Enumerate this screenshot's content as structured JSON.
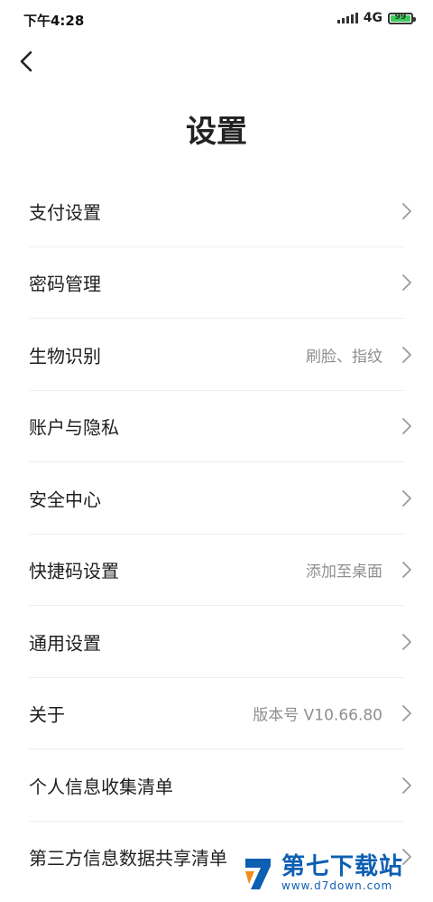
{
  "status_bar": {
    "time": "下午4:28",
    "network": "4G",
    "battery": "99",
    "battery_level": 0.99,
    "battery_color": "#3ec95c"
  },
  "header": {
    "back_icon": "chevron-left-icon",
    "title": "设置"
  },
  "settings": [
    {
      "label": "支付设置",
      "value": ""
    },
    {
      "label": "密码管理",
      "value": ""
    },
    {
      "label": "生物识别",
      "value": "刷脸、指纹"
    },
    {
      "label": "账户与隐私",
      "value": ""
    },
    {
      "label": "安全中心",
      "value": ""
    },
    {
      "label": "快捷码设置",
      "value": "添加至桌面"
    },
    {
      "label": "通用设置",
      "value": ""
    },
    {
      "label": "关于",
      "value": "版本号 V10.66.80"
    },
    {
      "label": "个人信息收集清单",
      "value": ""
    },
    {
      "label": "第三方信息数据共享清单",
      "value": ""
    }
  ],
  "watermark": {
    "title": "第七下载站",
    "url": "www.d7down.com",
    "color": "#0d5fb3"
  },
  "colors": {
    "text_primary": "#1f1f1f",
    "text_secondary": "#8f8f8f",
    "divider": "#efefef"
  }
}
